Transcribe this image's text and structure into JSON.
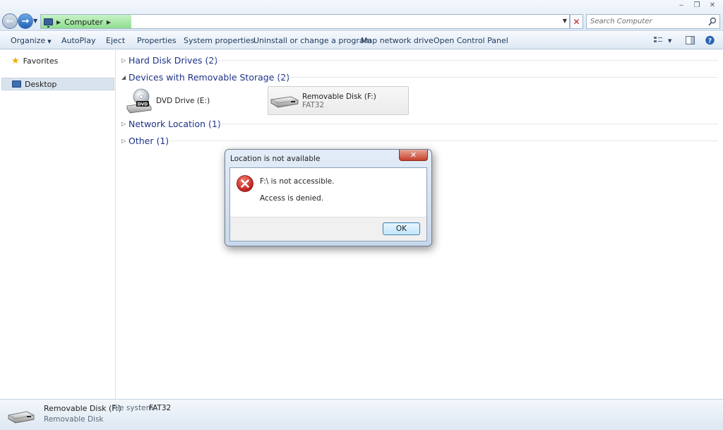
{
  "window": {
    "controls": {
      "minimize": "‒",
      "maximize": "❐",
      "close": "✕"
    }
  },
  "address": {
    "location": "Computer",
    "search_placeholder": "Search Computer"
  },
  "toolbar": {
    "items": [
      "Organize",
      "AutoPlay",
      "Eject",
      "Properties",
      "System properties",
      "Uninstall or change a program",
      "Map network drive",
      "Open Control Panel"
    ]
  },
  "nav": {
    "favorites": "Favorites",
    "desktop": "Desktop"
  },
  "groups": {
    "hdd": "Hard Disk Drives (2)",
    "removable": "Devices with Removable Storage (2)",
    "network": "Network Location (1)",
    "other": "Other (1)"
  },
  "drives": {
    "dvd": {
      "name": "DVD Drive (E:)",
      "label": "DVD"
    },
    "removable": {
      "name": "Removable Disk (F:)",
      "fs": "FAT32"
    }
  },
  "dialog": {
    "title": "Location is not available",
    "close": "✕",
    "message1": "F:\\ is not accessible.",
    "message2": "Access is denied.",
    "ok": "OK"
  },
  "details": {
    "name": "Removable Disk (F:)",
    "fs_label": "File system:",
    "fs_value": "FAT32",
    "type": "Removable Disk"
  },
  "colors": {
    "group_title": "#1e3287",
    "error_red": "#d42323",
    "address_progress": "#8ede8e"
  },
  "icons": {
    "back": "back-arrow-icon",
    "forward": "forward-arrow-icon",
    "search": "search-icon",
    "error": "error-icon"
  }
}
